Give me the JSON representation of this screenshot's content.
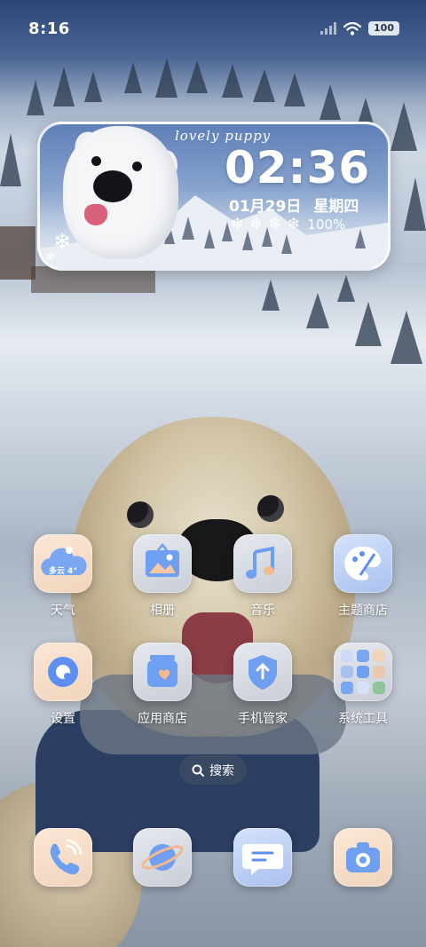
{
  "status_bar": {
    "time": "8:16",
    "battery": "100"
  },
  "widget": {
    "caption": "lovely puppy",
    "time": "02:36",
    "date": "01月29日",
    "weekday": "星期四",
    "battery": "100%"
  },
  "apps": [
    {
      "label": "天气",
      "icon": "weather-icon",
      "weather_text": "多云 4°"
    },
    {
      "label": "相册",
      "icon": "gallery-icon"
    },
    {
      "label": "音乐",
      "icon": "music-icon"
    },
    {
      "label": "主题商店",
      "icon": "palette-icon"
    },
    {
      "label": "设置",
      "icon": "settings-gear-icon"
    },
    {
      "label": "应用商店",
      "icon": "app-store-icon"
    },
    {
      "label": "手机管家",
      "icon": "security-shield-icon"
    },
    {
      "label": "系统工具",
      "icon": "folder-icon"
    }
  ],
  "search": {
    "label": "搜索"
  },
  "dock": [
    {
      "name": "phone",
      "icon": "phone-icon"
    },
    {
      "name": "browser",
      "icon": "planet-icon"
    },
    {
      "name": "messages",
      "icon": "message-icon"
    },
    {
      "name": "camera",
      "icon": "camera-icon"
    }
  ],
  "colors": {
    "icon_warm": "#f1d4bc",
    "icon_cool": "#c8cdd7",
    "icon_blue": "#a9c1ef",
    "glyph_blue": "#5c8ff0"
  }
}
